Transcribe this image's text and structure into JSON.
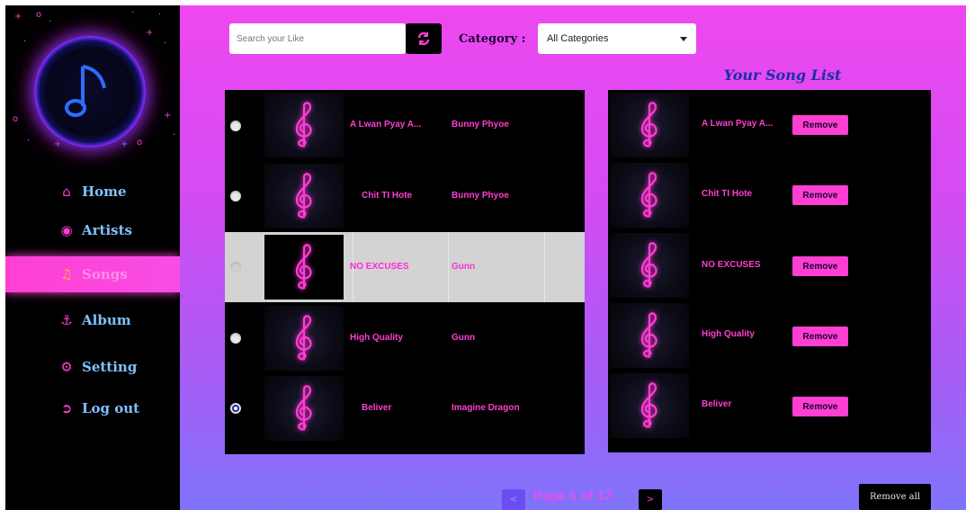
{
  "sidebar": {
    "items": [
      {
        "label": "Home",
        "icon": "home-icon"
      },
      {
        "label": "Artists",
        "icon": "users-icon"
      },
      {
        "label": "Songs",
        "icon": "music-icon",
        "active": true
      },
      {
        "label": "Album",
        "icon": "anchor-icon"
      },
      {
        "label": "Setting",
        "icon": "gear-icon"
      },
      {
        "label": "Log out",
        "icon": "logout-icon"
      }
    ]
  },
  "search": {
    "placeholder": "Search your Like",
    "value": ""
  },
  "category": {
    "label": "Category :",
    "selected": "All Categories"
  },
  "playlist": {
    "title": "Your Song List",
    "remove_label": "Remove"
  },
  "songs": [
    {
      "title": "A Lwan Pyay A...",
      "artist": "Bunny Phyoe"
    },
    {
      "title": "Chit TI Hote",
      "artist": "Bunny Phyoe"
    },
    {
      "title": "NO EXCUSES",
      "artist": "Gunn"
    },
    {
      "title": "High Quality",
      "artist": "Gunn"
    },
    {
      "title": "Beliver",
      "artist": "Imagine Dragon"
    }
  ],
  "playlist_songs": [
    {
      "title": "A Lwan Pyay A..."
    },
    {
      "title": "Chit TI Hote"
    },
    {
      "title": "NO EXCUSES"
    },
    {
      "title": "High Quality"
    },
    {
      "title": "Beliver"
    }
  ],
  "pagination": {
    "text": "Page 1 of 17",
    "prev": "<",
    "next": ">"
  },
  "actions": {
    "remove_all": "Remove all"
  },
  "colors": {
    "accent": "#ff3fd2",
    "nav_text": "#7fc2ff",
    "title_blue": "#1d2fa8"
  }
}
